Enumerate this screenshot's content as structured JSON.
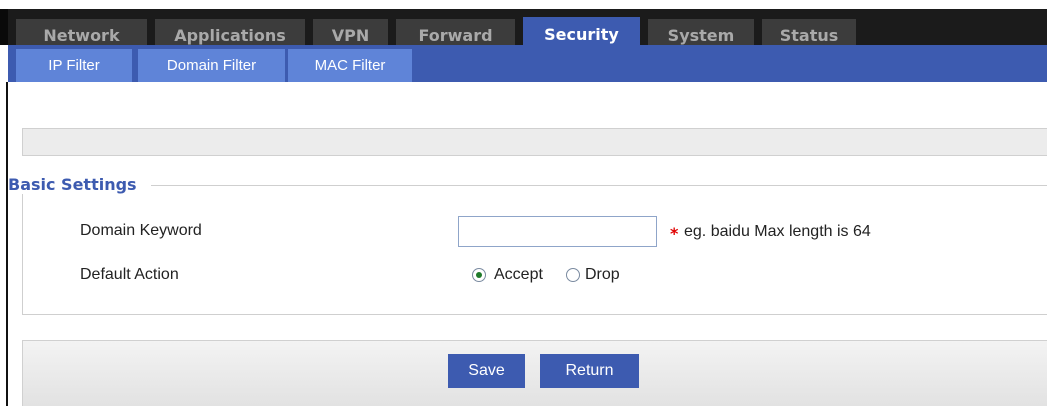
{
  "main_nav": {
    "tabs": [
      {
        "label": "Network"
      },
      {
        "label": "Applications"
      },
      {
        "label": "VPN"
      },
      {
        "label": "Forward"
      },
      {
        "label": "Security",
        "active": true
      },
      {
        "label": "System"
      },
      {
        "label": "Status"
      }
    ]
  },
  "sub_nav": {
    "tabs": [
      {
        "label": "IP Filter"
      },
      {
        "label": "Domain Filter"
      },
      {
        "label": "MAC Filter"
      }
    ]
  },
  "basic_settings": {
    "legend": "Basic Settings",
    "domain_keyword": {
      "label": "Domain Keyword",
      "value": "",
      "required_mark": "*",
      "hint": "eg. baidu Max length is 64"
    },
    "default_action": {
      "label": "Default Action",
      "options": [
        {
          "label": "Accept",
          "checked": true
        },
        {
          "label": "Drop",
          "checked": false
        }
      ]
    }
  },
  "actions": {
    "save_label": "Save",
    "return_label": "Return"
  },
  "colors": {
    "nav_dark": "#1b1b1b",
    "tab_inactive": "#3c3c3c",
    "accent_blue": "#3d5bb0",
    "subtab_blue": "#5f84d8",
    "required_red": "#e00000"
  }
}
